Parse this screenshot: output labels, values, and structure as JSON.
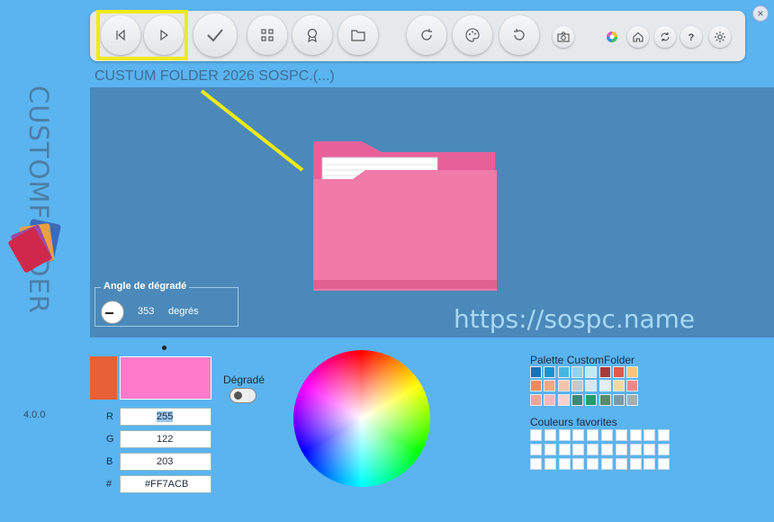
{
  "app": {
    "vertical_title": "CUSTOMFOLDER",
    "version": "4.0.0"
  },
  "window": {
    "close_label": "×"
  },
  "toolbar": {
    "buttons": [
      {
        "name": "previous-button",
        "icon": "skip-previous-icon"
      },
      {
        "name": "next-button",
        "icon": "play-next-icon"
      },
      {
        "name": "apply-button",
        "icon": "check-icon"
      },
      {
        "name": "grid-button",
        "icon": "grid-icon"
      },
      {
        "name": "badge-button",
        "icon": "award-icon"
      },
      {
        "name": "folder-button",
        "icon": "folder-icon"
      },
      {
        "name": "refresh-button",
        "icon": "redo-icon"
      },
      {
        "name": "palette-button",
        "icon": "palette-icon"
      },
      {
        "name": "undo-button",
        "icon": "undo-icon"
      },
      {
        "name": "camera-button",
        "icon": "camera-icon"
      },
      {
        "name": "color-wheel-button",
        "icon": "color-wheel-icon"
      },
      {
        "name": "home-button",
        "icon": "home-icon"
      },
      {
        "name": "sync-button",
        "icon": "sync-icon"
      },
      {
        "name": "help-button",
        "icon": "question-icon"
      },
      {
        "name": "settings-button",
        "icon": "gear-icon"
      }
    ]
  },
  "file_path": "CUSTUM FOLDER 2026 SOSPC.(...)",
  "preview": {
    "watermark": "https://sospc.name",
    "folder_color": "#ff7acb"
  },
  "gradient_angle": {
    "label": "Angle de dégradé",
    "value": "353",
    "unit": "degrés"
  },
  "color": {
    "old_color": "#e86035",
    "new_color": "#ff7acb",
    "r_label": "R",
    "r_value": "255",
    "g_label": "G",
    "g_value": "122",
    "b_label": "B",
    "b_value": "203",
    "hex_label": "#",
    "hex_value": "#FF7ACB"
  },
  "gradient_toggle": {
    "label": "Dégradé"
  },
  "palette": {
    "title": "Palette CustomFolder",
    "colors": [
      "#1a72b8",
      "#1a92cc",
      "#45b8e0",
      "#8dd4ec",
      "#c4e8f4",
      "#a83a3a",
      "#e05a4a",
      "#f4c77a",
      "#f08a5a",
      "#f4a880",
      "#f4c4a8",
      "#c8c8c8",
      "#d8e8f0",
      "#e4eef4",
      "#f4d8a0",
      "#f08888",
      "#f4a0a0",
      "#f4b8b8",
      "#f8d0d0",
      "#3a8a7a",
      "#2a9a6a",
      "#5a8a6a",
      "#7a9aaa",
      "#a0b0b8"
    ]
  },
  "favorites": {
    "title": "Couleurs favorites"
  }
}
